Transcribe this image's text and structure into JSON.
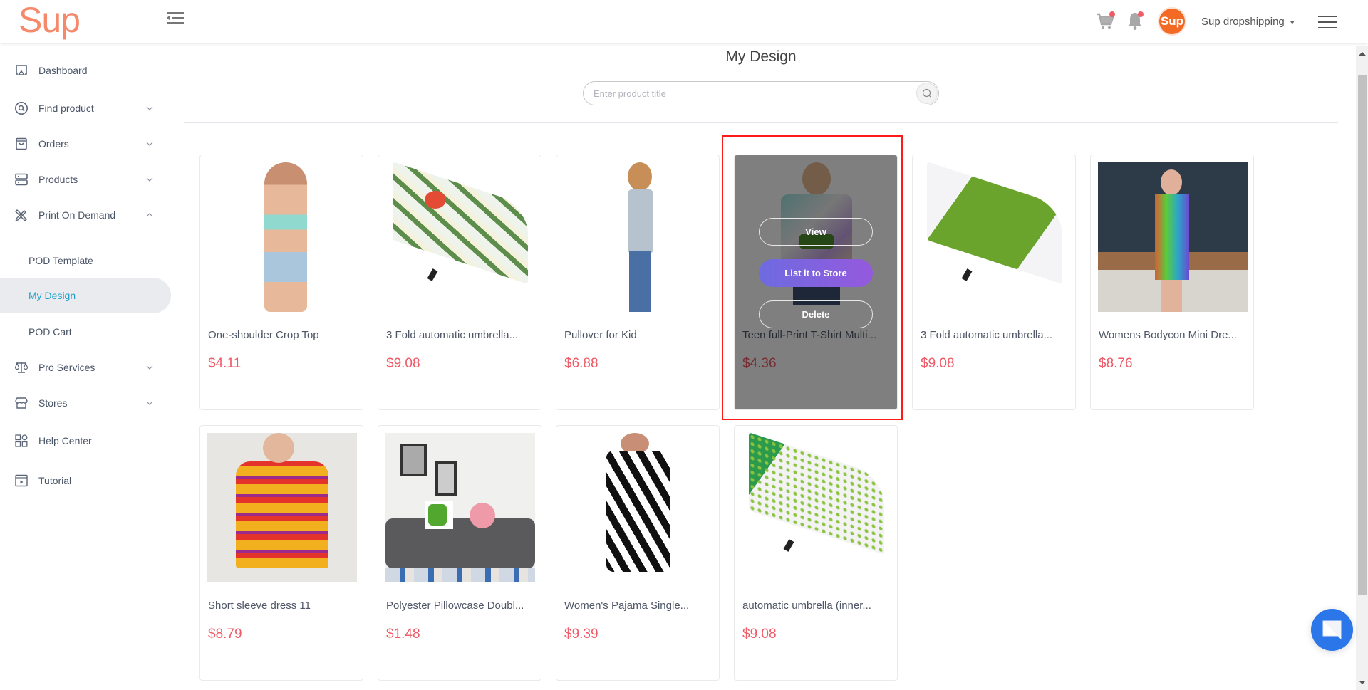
{
  "header": {
    "logo": "Sup",
    "avatar_text": "Sup",
    "account_name": "Sup dropshipping",
    "cart_has_notification": true,
    "bell_has_notification": true
  },
  "sidebar": {
    "items": [
      {
        "label": "Dashboard",
        "icon": "monitor-icon",
        "expandable": false
      },
      {
        "label": "Find product",
        "icon": "search-circle-icon",
        "expandable": true,
        "expanded": false
      },
      {
        "label": "Orders",
        "icon": "bag-icon",
        "expandable": true,
        "expanded": false
      },
      {
        "label": "Products",
        "icon": "server-icon",
        "expandable": true,
        "expanded": false
      },
      {
        "label": "Print On Demand",
        "icon": "pencil-ruler-icon",
        "expandable": true,
        "expanded": true
      },
      {
        "label": "Pro Services",
        "icon": "scale-icon",
        "expandable": true,
        "expanded": false
      },
      {
        "label": "Stores",
        "icon": "store-icon",
        "expandable": true,
        "expanded": false
      },
      {
        "label": "Help Center",
        "icon": "grid-icon",
        "expandable": false
      },
      {
        "label": "Tutorial",
        "icon": "video-icon",
        "expandable": false
      }
    ],
    "pod_subitems": [
      {
        "label": "POD Template",
        "active": false
      },
      {
        "label": "My Design",
        "active": true
      },
      {
        "label": "POD Cart",
        "active": false
      }
    ]
  },
  "main": {
    "title": "My Design",
    "search": {
      "placeholder": "Enter product title",
      "value": ""
    },
    "hover_actions": {
      "view": "View",
      "list": "List it to Store",
      "delete": "Delete"
    },
    "products": [
      {
        "title": "One-shoulder Crop Top",
        "price": "$4.11",
        "image": "crop-top-model"
      },
      {
        "title": "3 Fold automatic umbrella...",
        "price": "$9.08",
        "image": "floral-umbrella"
      },
      {
        "title": "Pullover for Kid",
        "price": "$6.88",
        "image": "kid-pullover"
      },
      {
        "title": "Teen full-Print T-Shirt Multi...",
        "price": "$4.36",
        "image": "teen-tshirt",
        "hovered": true
      },
      {
        "title": "3 Fold automatic umbrella...",
        "price": "$9.08",
        "image": "dinosaur-umbrella"
      },
      {
        "title": "Womens Bodycon Mini Dre...",
        "price": "$8.76",
        "image": "bodycon-dress"
      },
      {
        "title": "Short sleeve dress 11",
        "price": "$8.79",
        "image": "short-sleeve-dress"
      },
      {
        "title": "Polyester Pillowcase Doubl...",
        "price": "$1.48",
        "image": "pillowcase-sofa"
      },
      {
        "title": "Women's Pajama Single...",
        "price": "$9.39",
        "image": "zebra-pajama"
      },
      {
        "title": "automatic umbrella (inner...",
        "price": "$9.08",
        "image": "leaf-umbrella"
      }
    ]
  },
  "colors": {
    "brand": "#f5896a",
    "active_link": "#1ba0c9",
    "price": "#ef5a67",
    "primary_button_start": "#6e6be0",
    "primary_button_end": "#9559dd",
    "chat": "#2b76e8",
    "highlight": "#ff1a1a"
  }
}
